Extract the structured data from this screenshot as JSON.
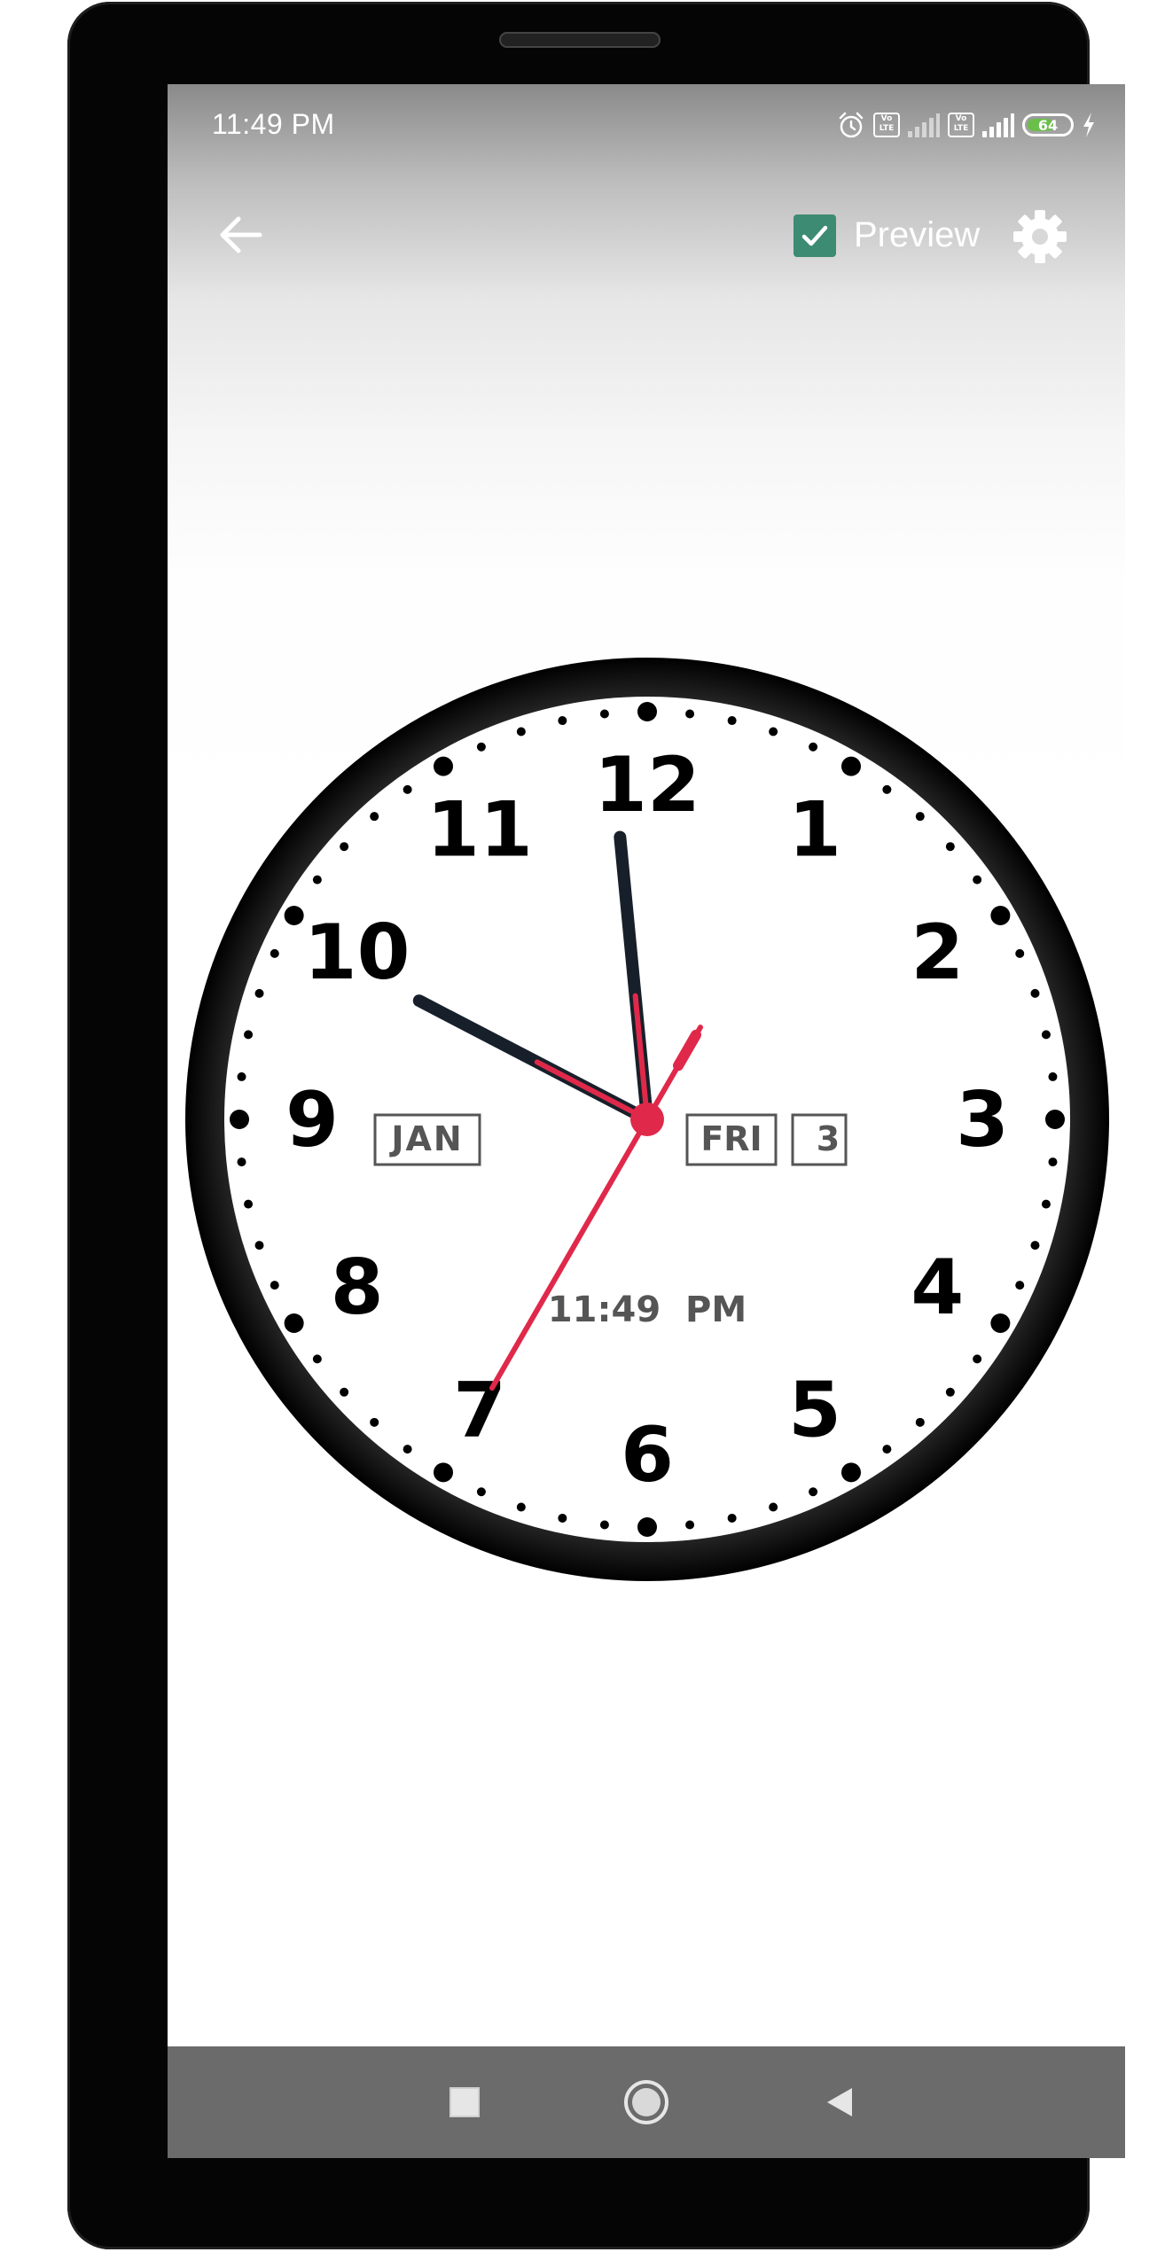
{
  "status_bar": {
    "time": "11:49 PM",
    "volte_1": "Vo LTE",
    "volte_2": "Vo LTE",
    "battery_level": "64",
    "battery_fraction": 0.64,
    "icons": [
      "alarm-icon",
      "volte-icon",
      "signal-icon",
      "volte-icon",
      "signal-icon",
      "battery-icon",
      "charging-icon"
    ]
  },
  "toolbar": {
    "back_icon": "arrow-left-icon",
    "preview_label": "Preview",
    "preview_checked": true,
    "settings_icon": "gear-icon"
  },
  "clock": {
    "numerals": [
      "12",
      "1",
      "2",
      "3",
      "4",
      "5",
      "6",
      "7",
      "8",
      "9",
      "10",
      "11"
    ],
    "month": "JAN",
    "weekday": "FRI",
    "day": "3",
    "digital_time": "11:49  PM",
    "hours": 11,
    "minutes": 49,
    "seconds": 35,
    "colors": {
      "bezel": "#111111",
      "face": "#ffffff",
      "numerals": "#000000",
      "hour_minute_hand": "#17202a",
      "accent_red": "#e0294a"
    }
  },
  "nav_bar": {
    "recents_icon": "square-recents-icon",
    "home_icon": "circle-home-icon",
    "back_icon": "triangle-back-icon"
  }
}
